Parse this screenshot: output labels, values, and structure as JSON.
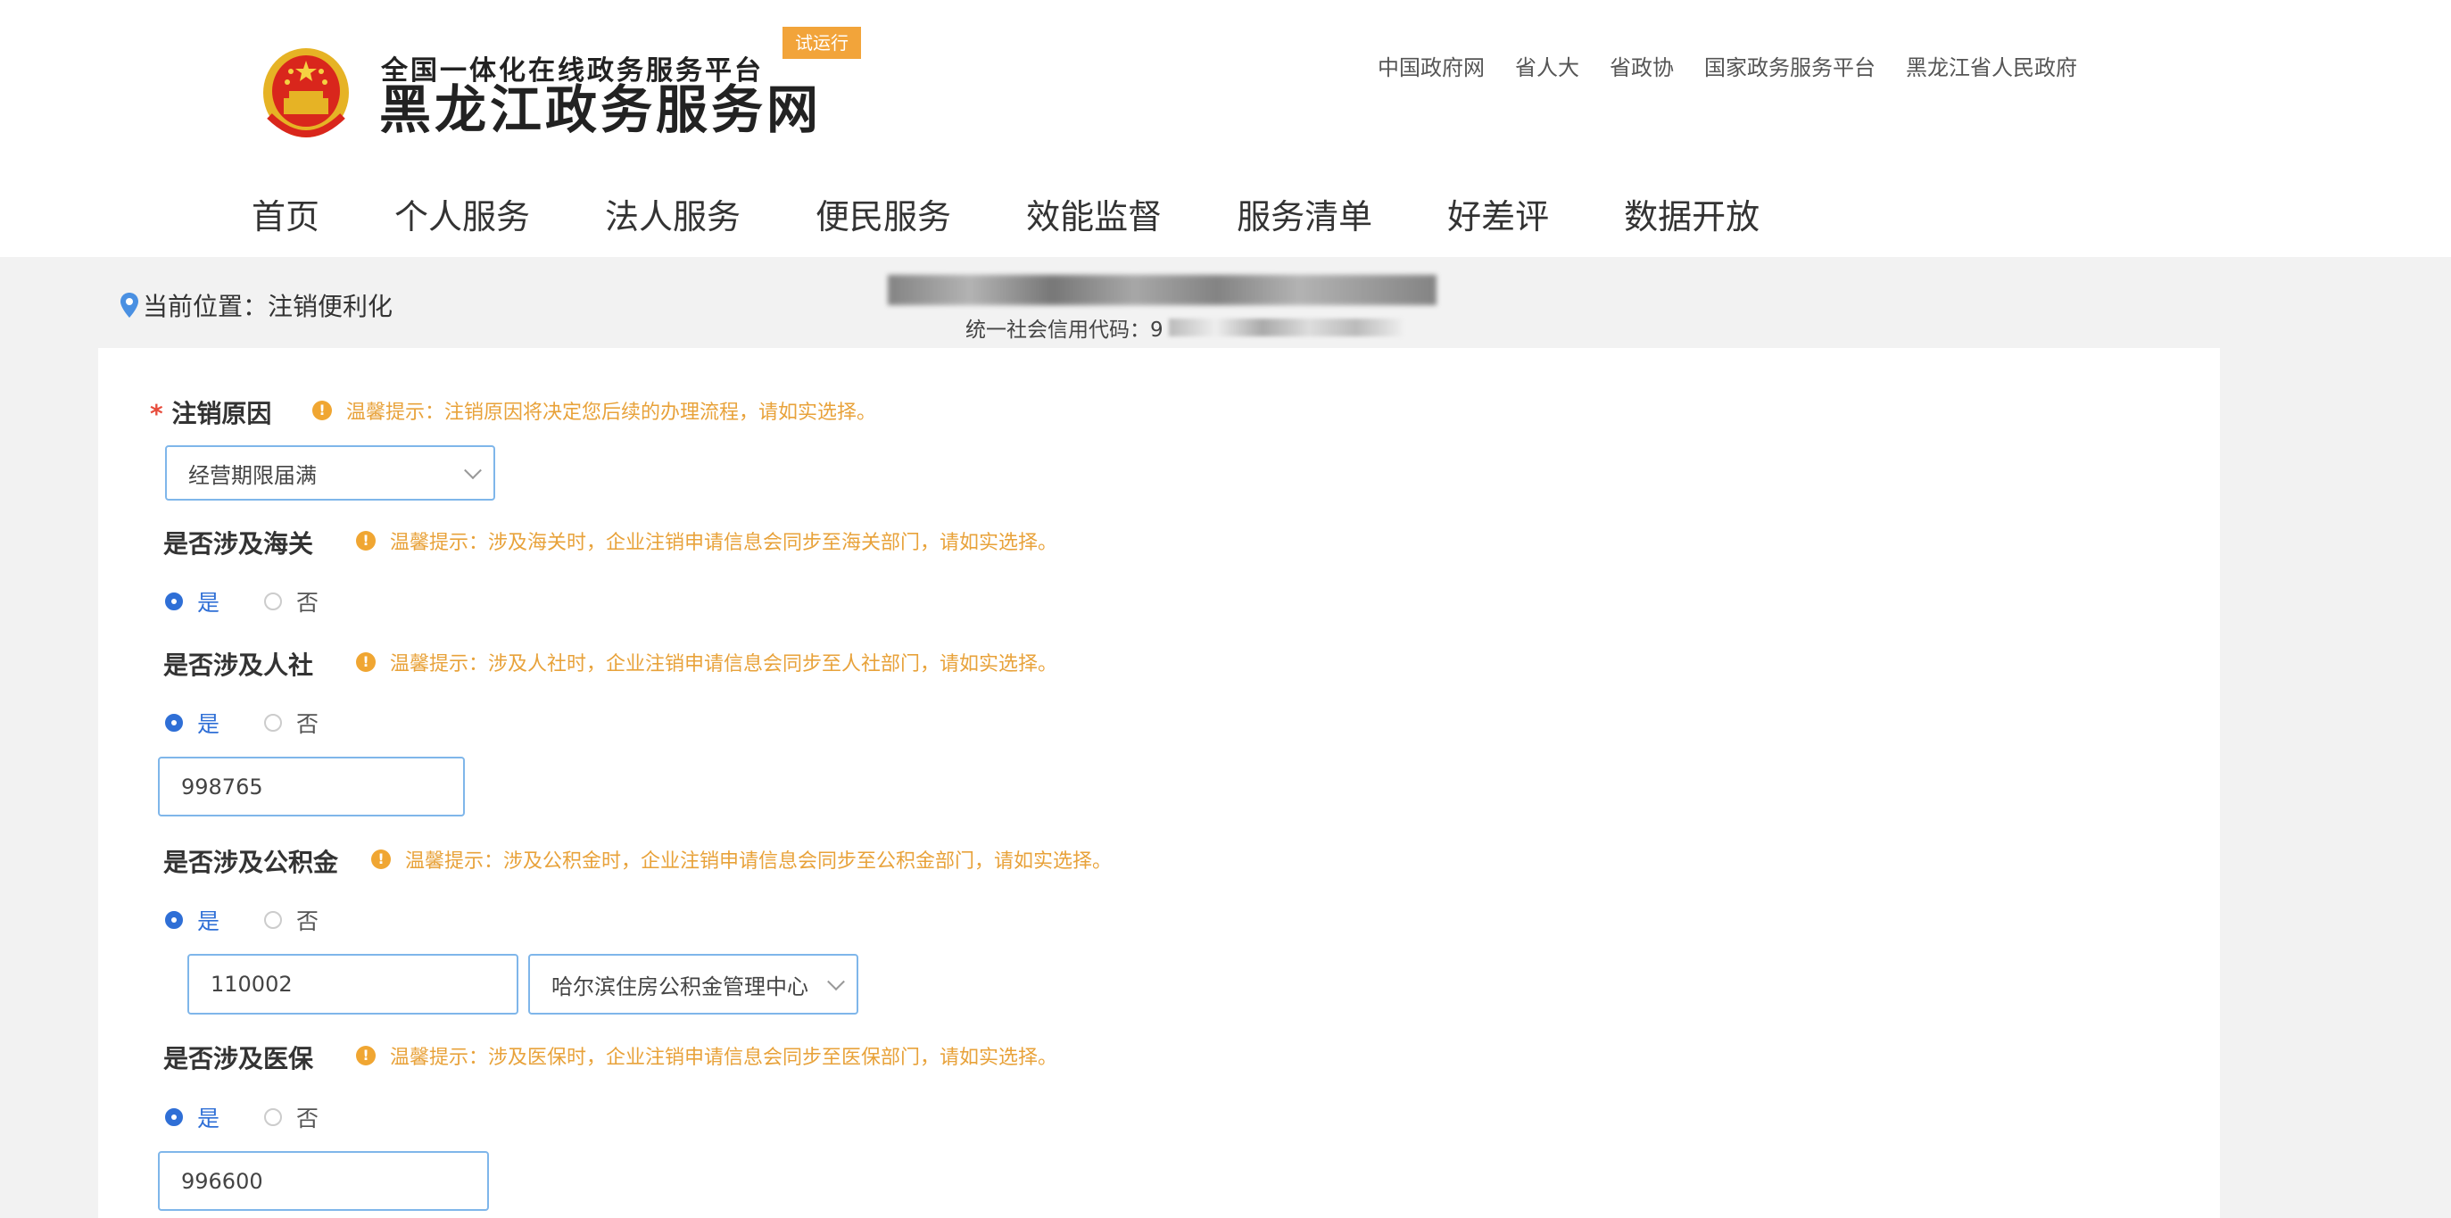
{
  "header": {
    "logo_subtitle": "全国一体化在线政务服务平台",
    "logo_title": "黑龙江政务服务网",
    "trial_badge": "试运行",
    "top_links": [
      "中国政府网",
      "省人大",
      "省政协",
      "国家政务服务平台",
      "黑龙江省人民政府"
    ],
    "nav": [
      "首页",
      "个人服务",
      "法人服务",
      "便民服务",
      "效能监督",
      "服务清单",
      "好差评",
      "数据开放"
    ]
  },
  "breadcrumb": {
    "label": "当前位置：注销便利化"
  },
  "company": {
    "credit_label": "统一社会信用代码：9"
  },
  "form": {
    "reason": {
      "label": "注销原因",
      "tip": "温馨提示：注销原因将决定您后续的办理流程，请如实选择。",
      "value": "经营期限届满"
    },
    "customs": {
      "label": "是否涉及海关",
      "tip": "温馨提示：涉及海关时，企业注销申请信息会同步至海关部门，请如实选择。",
      "yes": "是",
      "no": "否",
      "selected": "yes"
    },
    "social": {
      "label": "是否涉及人社",
      "tip": "温馨提示：涉及人社时，企业注销申请信息会同步至人社部门，请如实选择。",
      "yes": "是",
      "no": "否",
      "selected": "yes",
      "value": "998765"
    },
    "fund": {
      "label": "是否涉及公积金",
      "tip": "温馨提示：涉及公积金时，企业注销申请信息会同步至公积金部门，请如实选择。",
      "yes": "是",
      "no": "否",
      "selected": "yes",
      "code_value": "110002",
      "center_value": "哈尔滨住房公积金管理中心"
    },
    "medical": {
      "label": "是否涉及医保",
      "tip": "温馨提示：涉及医保时，企业注销申请信息会同步至医保部门，请如实选择。",
      "yes": "是",
      "no": "否",
      "selected": "yes",
      "value": "996600"
    }
  },
  "colors": {
    "accent": "#2f6fd6",
    "tip": "#e8a23a",
    "badge": "#f2a43a",
    "required": "#e74c3c"
  }
}
